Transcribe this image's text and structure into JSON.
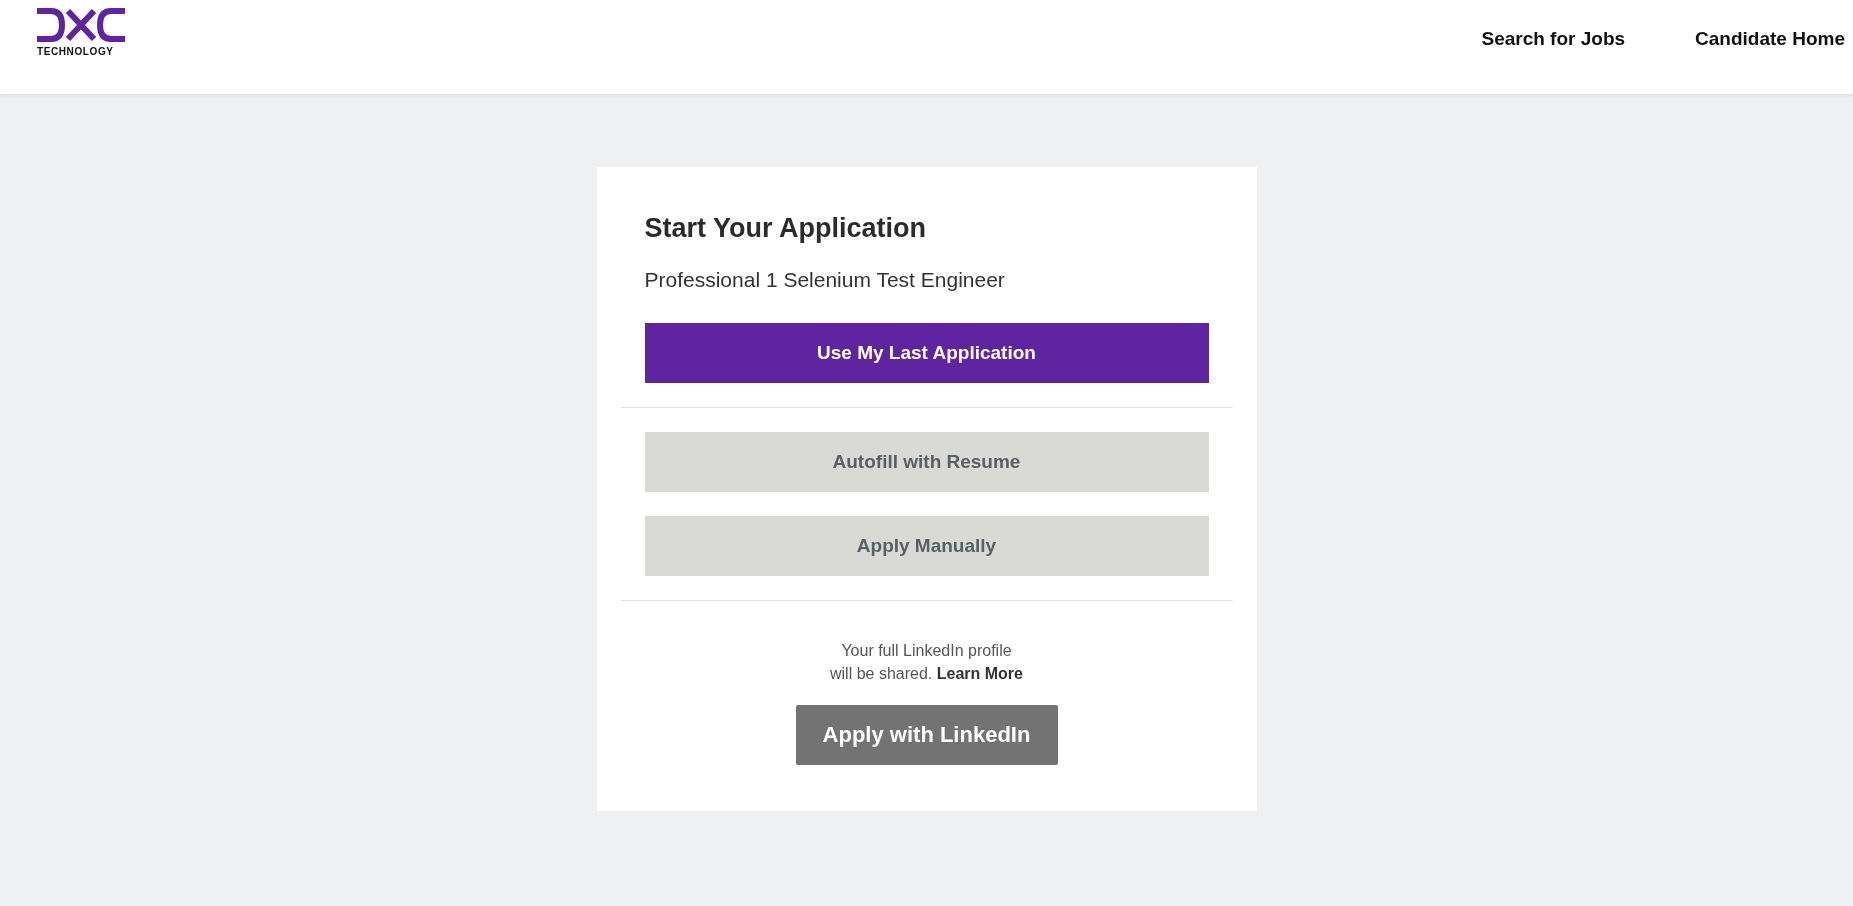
{
  "header": {
    "logo": {
      "text": "TECHNOLOGY"
    },
    "nav": [
      {
        "label": "Search for Jobs"
      },
      {
        "label": "Candidate Home"
      }
    ]
  },
  "card": {
    "title": "Start Your Application",
    "job_title": "Professional 1 Selenium Test Engineer",
    "button_groups": [
      [
        {
          "label": "Use My Last Application",
          "kind": "primary"
        }
      ],
      [
        {
          "label": "Autofill with Resume",
          "kind": "secondary"
        },
        {
          "label": "Apply Manually",
          "kind": "secondary"
        }
      ]
    ],
    "linkedin": {
      "notice": "Your full LinkedIn profile\nwill be shared.",
      "link": "Learn More",
      "button": "Apply with LinkedIn"
    }
  }
}
